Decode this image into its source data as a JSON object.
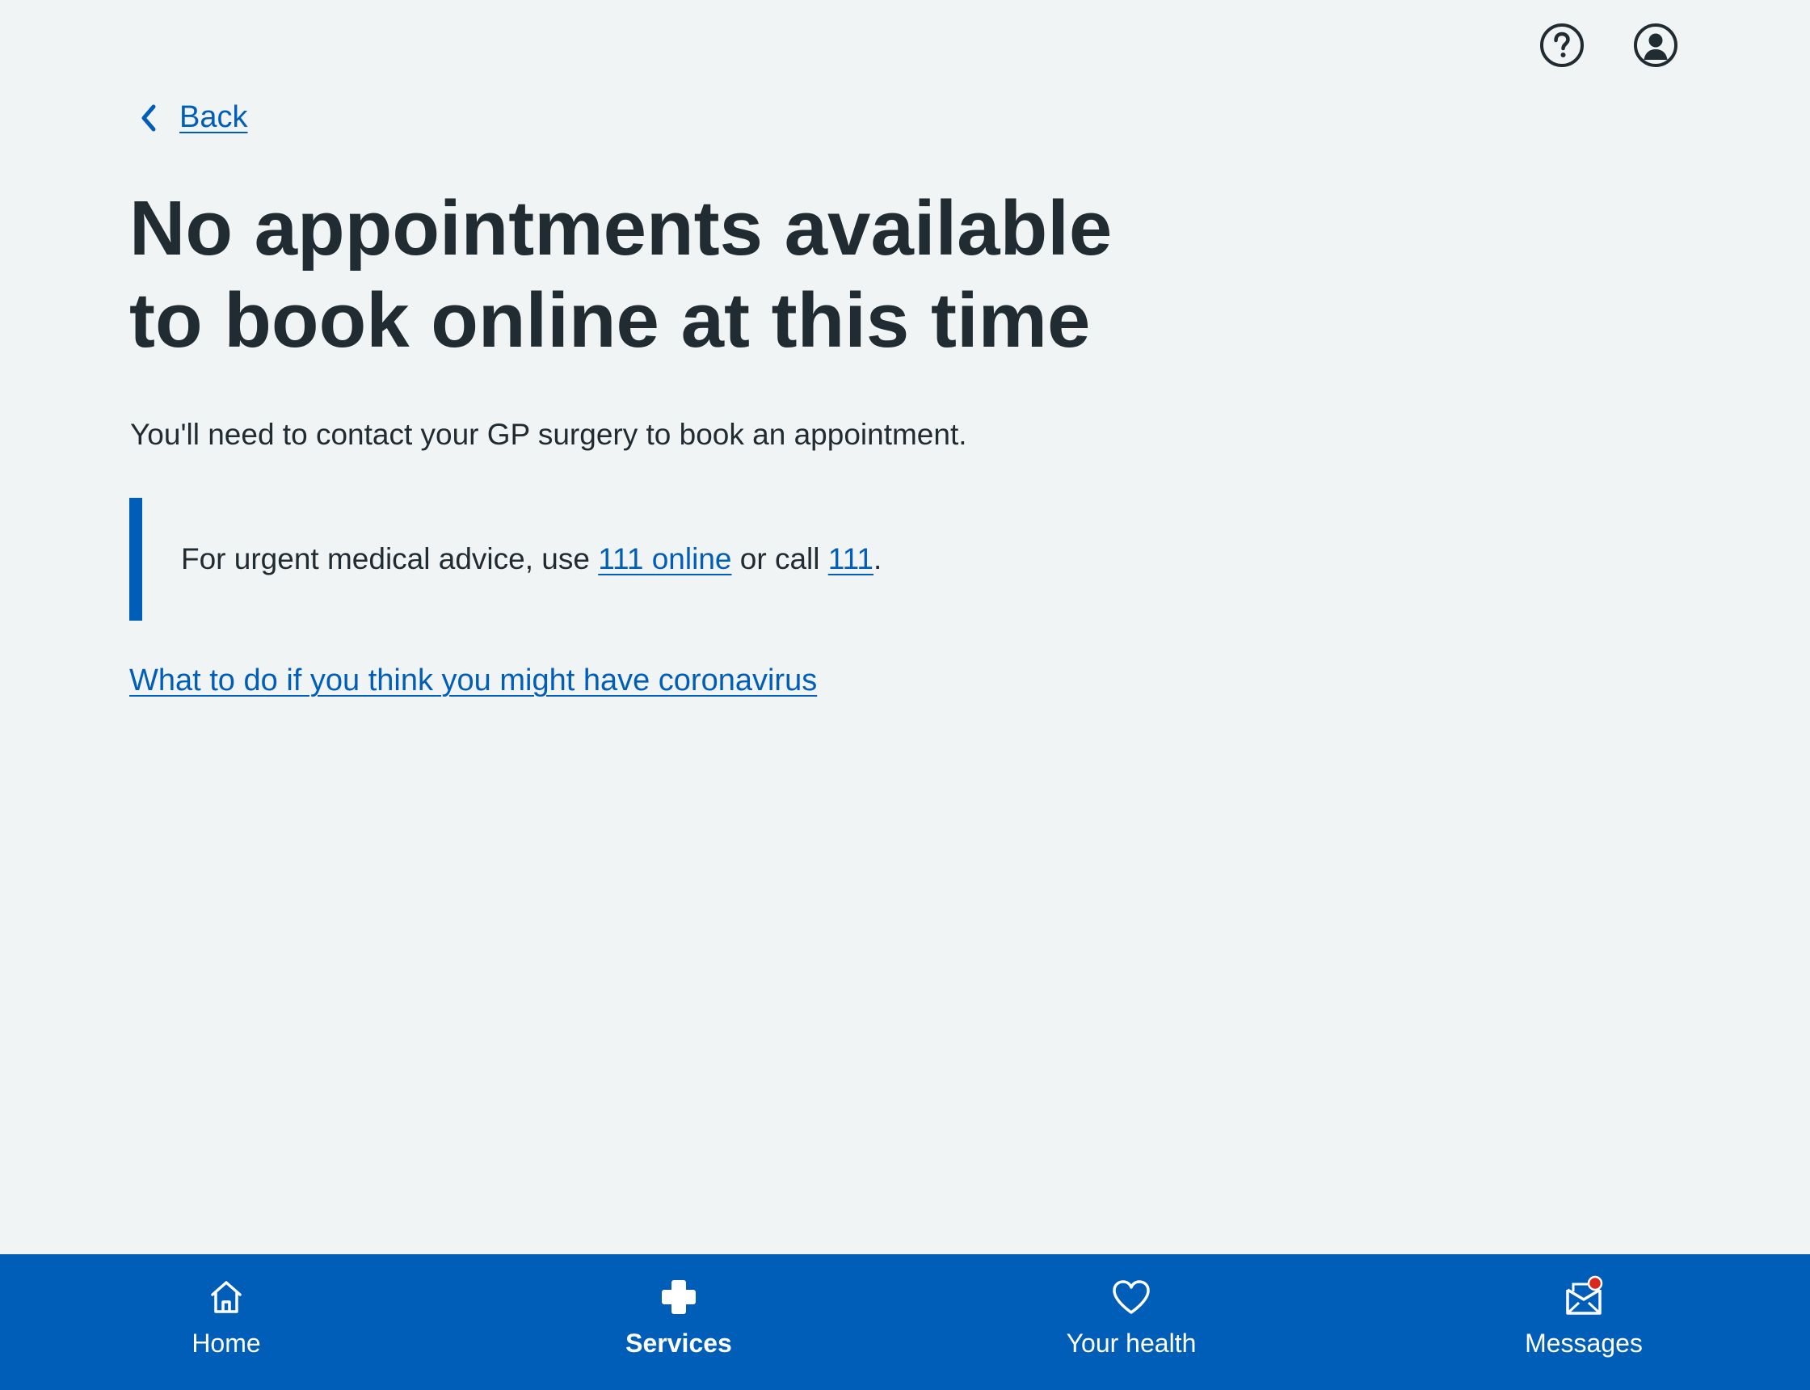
{
  "header": {
    "help_icon": "help-icon",
    "account_icon": "account-icon"
  },
  "back": {
    "label": "Back"
  },
  "page": {
    "title": "No appointments available to book online at this time",
    "intro": "You'll need to contact your GP surgery to book an appointment.",
    "inset": {
      "text_before": "For urgent medical advice, use ",
      "link_online": "111 online",
      "text_middle": " or call ",
      "link_call": "111",
      "text_after": "."
    },
    "coronavirus_link": "What to do if you think you might have coronavirus"
  },
  "bottom_nav": {
    "items": [
      {
        "label": "Home",
        "icon": "home-icon",
        "active": false
      },
      {
        "label": "Services",
        "icon": "services-cross-icon",
        "active": true
      },
      {
        "label": "Your health",
        "icon": "heart-icon",
        "active": false
      },
      {
        "label": "Messages",
        "icon": "messages-envelope-icon",
        "active": false,
        "badge": true
      }
    ]
  },
  "colors": {
    "background": "#f0f4f5",
    "brand_blue": "#005eb8",
    "text": "#212b32",
    "badge_red": "#da291c"
  }
}
